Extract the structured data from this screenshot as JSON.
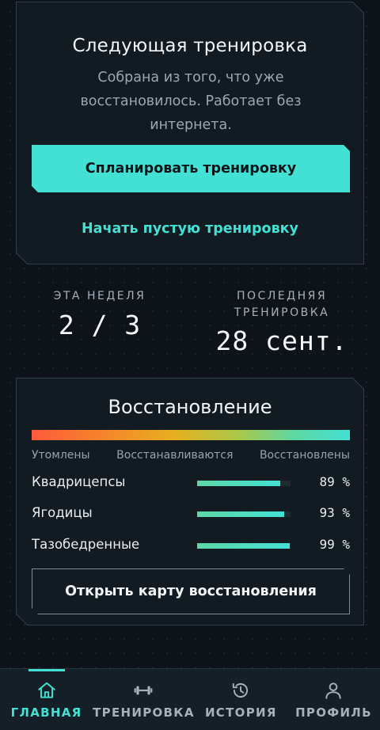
{
  "next_workout": {
    "title": "Следующая тренировка",
    "subtitle": "Собрана из того, что уже восстановилось. Работает без интернета.",
    "plan_button": "Спланировать тренировку",
    "empty_button": "Начать пустую тренировку"
  },
  "stats": {
    "week_label": "ЭТА НЕДЕЛЯ",
    "week_value": "2 / 3",
    "last_label": "ПОСЛЕДНЯЯ ТРЕНИРОВКА",
    "last_value": "28 сент."
  },
  "recovery": {
    "title": "Восстановление",
    "scale": [
      "Утомлены",
      "Восстанавливаются",
      "Восстановлены"
    ],
    "muscles": [
      {
        "name": "Квадрицепсы",
        "percent_label": "89 %",
        "value": 89
      },
      {
        "name": "Ягодицы",
        "percent_label": "93 %",
        "value": 93
      },
      {
        "name": "Тазобедренные",
        "percent_label": "99 %",
        "value": 99
      }
    ],
    "map_button": "Открыть карту восстановления"
  },
  "tabs": [
    {
      "label": "ГЛАВНАЯ",
      "icon": "home-icon",
      "active": true
    },
    {
      "label": "ТРЕНИРОВКА",
      "icon": "dumbbell-icon",
      "active": false
    },
    {
      "label": "ИСТОРИЯ",
      "icon": "history-icon",
      "active": false
    },
    {
      "label": "ПРОФИЛЬ",
      "icon": "profile-icon",
      "active": false
    }
  ],
  "colors": {
    "accent": "#43e0d4",
    "background": "#0d1318",
    "card": "#131b22"
  }
}
